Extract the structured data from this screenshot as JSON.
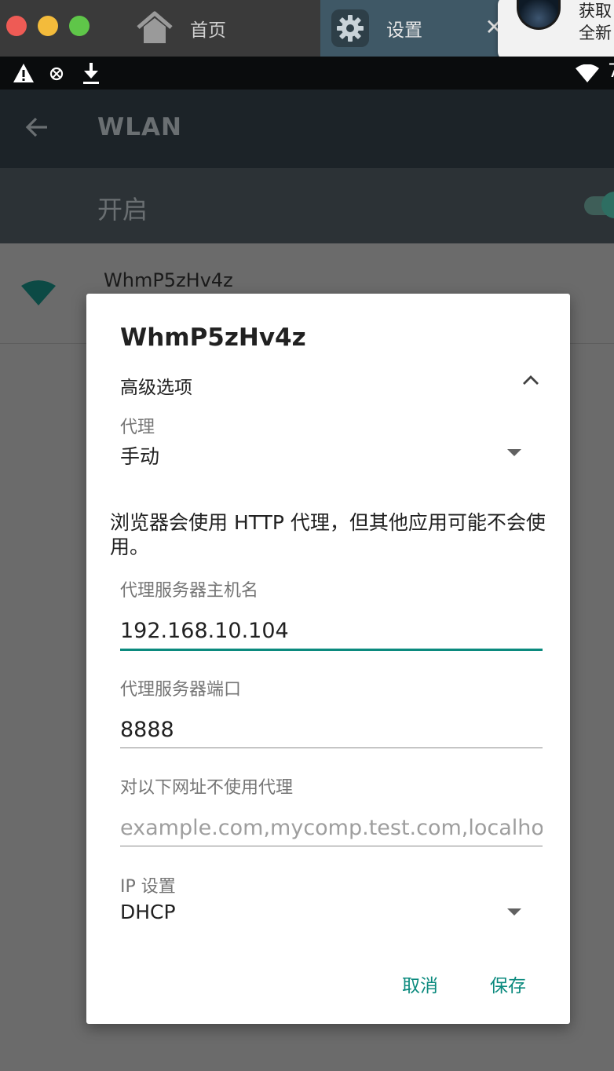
{
  "window": {
    "tabs": [
      {
        "label": "首页",
        "icon": "home-icon"
      },
      {
        "label": "设置",
        "icon": "gear-icon"
      }
    ],
    "notification": {
      "line1": "获取",
      "line2": "全新"
    },
    "colors": {
      "red": "#ee5b55",
      "yellow": "#f3bb3b",
      "green": "#5fc649",
      "tab_active": "#3f5866",
      "accent": "#0b8a7e"
    }
  },
  "status_bar": {
    "left_icons": [
      "warning-icon",
      "no-data-icon",
      "download-icon"
    ],
    "right_icons": [
      "wifi-signal-icon"
    ],
    "right_text": "7"
  },
  "toolbar": {
    "title": "WLAN"
  },
  "switch_bar": {
    "label": "开启",
    "enabled": true
  },
  "networks": [
    {
      "name": "WhmP5zHv4z"
    }
  ],
  "dialog": {
    "title": "WhmP5zHv4z",
    "advanced_label": "高级选项",
    "proxy": {
      "label": "代理",
      "value": "手动"
    },
    "note": "浏览器会使用 HTTP 代理，但其他应用可能不会使用。",
    "proxy_host": {
      "label": "代理服务器主机名",
      "value": "192.168.10.104"
    },
    "proxy_port": {
      "label": "代理服务器端口",
      "value": "8888"
    },
    "bypass": {
      "label": "对以下网址不使用代理",
      "placeholder": "example.com,mycomp.test.com,localhost"
    },
    "ip_settings": {
      "label": "IP 设置",
      "value": "DHCP"
    },
    "buttons": {
      "cancel": "取消",
      "save": "保存"
    }
  }
}
